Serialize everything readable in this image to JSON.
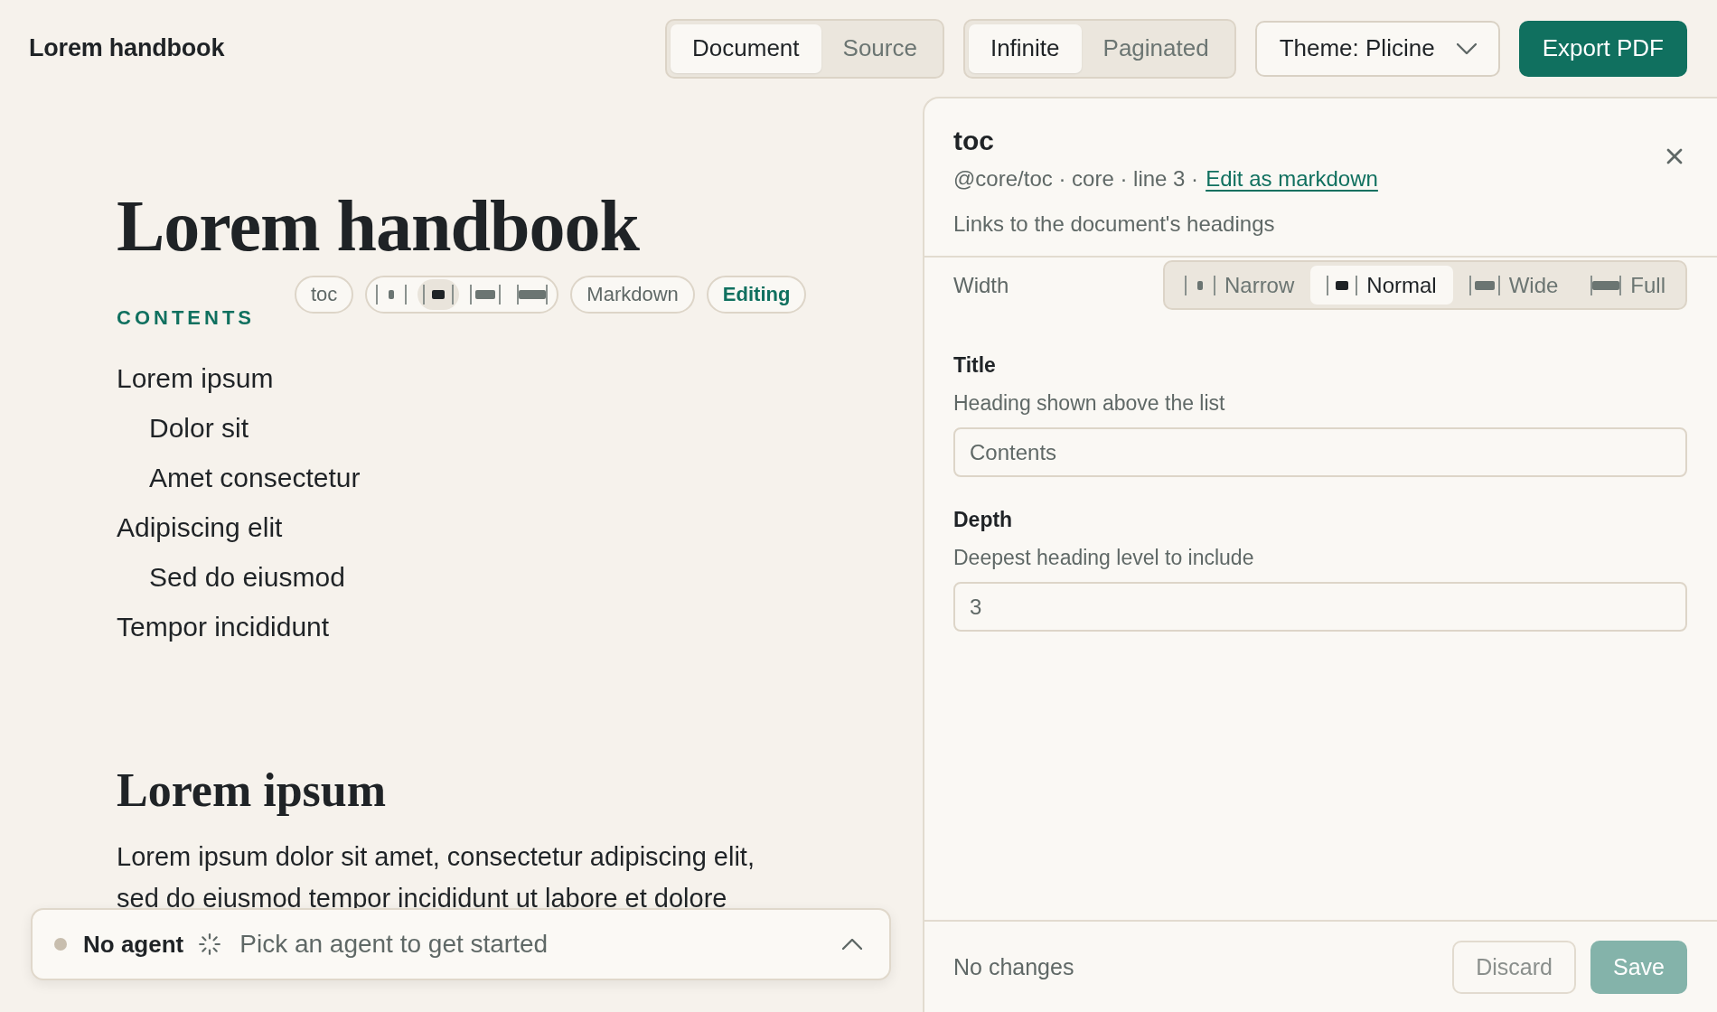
{
  "header": {
    "title": "Lorem handbook",
    "view_tabs": [
      {
        "label": "Document",
        "selected": true
      },
      {
        "label": "Source",
        "selected": false
      }
    ],
    "layout_tabs": [
      {
        "label": "Infinite",
        "selected": true
      },
      {
        "label": "Paginated",
        "selected": false
      }
    ],
    "theme_select": {
      "value": "Theme: Plicine"
    },
    "export_button": "Export PDF"
  },
  "document": {
    "title": "Lorem handbook",
    "toc_block": {
      "heading": "CONTENTS",
      "toolbar": {
        "block_name": "toc",
        "widths": [
          {
            "kind": "narrow",
            "selected": false
          },
          {
            "kind": "normal",
            "selected": true
          },
          {
            "kind": "wide",
            "selected": false
          },
          {
            "kind": "full",
            "selected": false
          }
        ],
        "markdown": "Markdown",
        "editing": "Editing"
      },
      "items": [
        {
          "label": "Lorem ipsum",
          "children": [
            {
              "label": "Dolor sit"
            },
            {
              "label": "Amet consectetur"
            }
          ]
        },
        {
          "label": "Adipiscing elit",
          "children": [
            {
              "label": "Sed do eiusmod"
            }
          ]
        },
        {
          "label": "Tempor incididunt"
        }
      ]
    },
    "sections": [
      {
        "heading": "Lorem ipsum",
        "paragraph": "Lorem ipsum dolor sit amet, consectetur adipiscing elit, sed do eiusmod tempor incididunt ut labore et dolore"
      }
    ]
  },
  "agent_bar": {
    "status": "No agent",
    "prompt": "Pick an agent to get started",
    "expanded": false
  },
  "inspector": {
    "title": "toc",
    "meta": "@core/toc · core · line 3 ·",
    "link": "Edit as markdown",
    "description": "Links to the document's headings",
    "width_label": "Width",
    "widths": [
      {
        "kind": "narrow",
        "label": "Narrow",
        "selected": false
      },
      {
        "kind": "normal",
        "label": "Normal",
        "selected": true
      },
      {
        "kind": "wide",
        "label": "Wide",
        "selected": false
      },
      {
        "kind": "full",
        "label": "Full",
        "selected": false
      }
    ],
    "fields": [
      {
        "label": "Title",
        "hint": "Heading shown above the list",
        "value": "Contents"
      },
      {
        "label": "Depth",
        "hint": "Deepest heading level to include",
        "value": "3"
      }
    ],
    "footer": {
      "status": "No changes",
      "discard": {
        "label": "Discard",
        "disabled": false
      },
      "save": {
        "label": "Save",
        "disabled": true
      }
    }
  }
}
